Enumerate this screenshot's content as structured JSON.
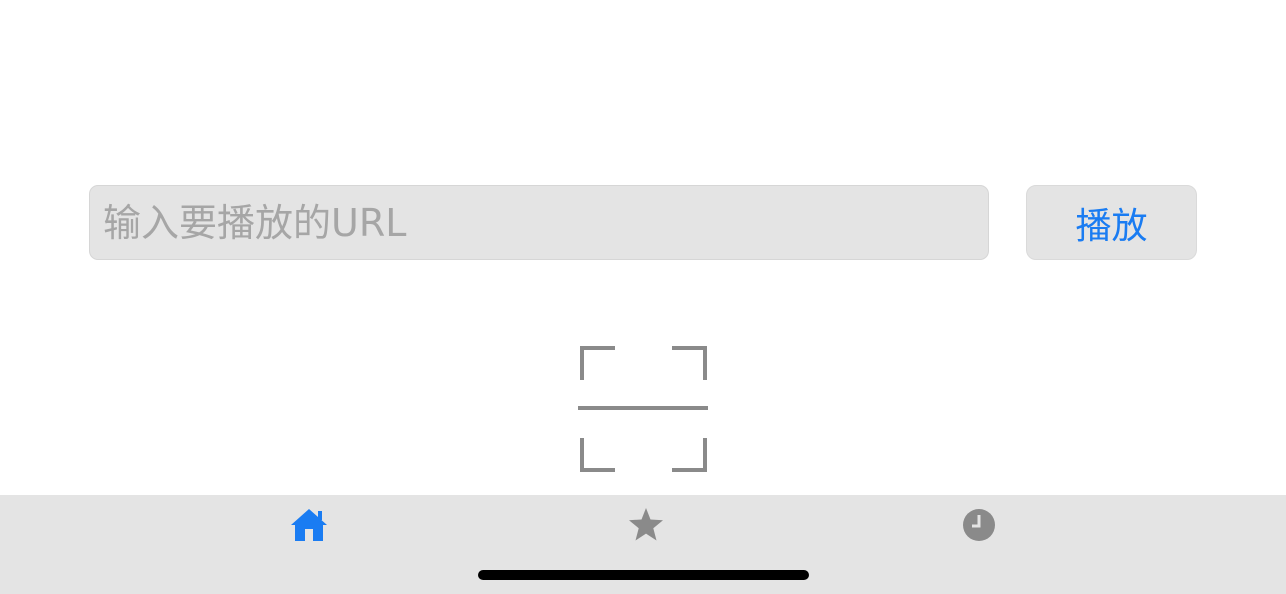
{
  "url_input": {
    "value": "",
    "placeholder": "输入要播放的URL"
  },
  "play_button": {
    "label": "播放"
  },
  "scan": {
    "icon": "scan-icon"
  },
  "tab_bar": {
    "items": [
      {
        "icon": "home-icon",
        "selected": true
      },
      {
        "icon": "star-icon",
        "selected": false
      },
      {
        "icon": "clock-icon",
        "selected": false
      }
    ]
  },
  "colors": {
    "accent": "#1a7cf2",
    "inactive_icon": "#8a8a8a",
    "field_background": "#e4e4e4",
    "tab_bar_background": "#e4e4e4"
  }
}
